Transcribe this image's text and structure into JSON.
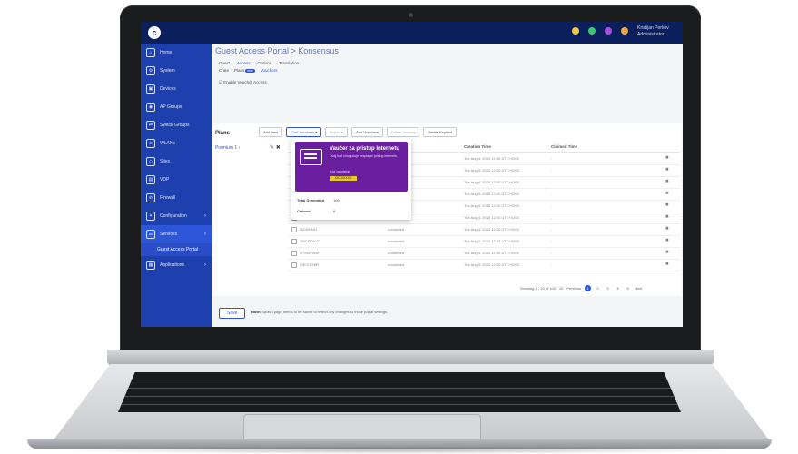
{
  "app": {
    "logo": "c",
    "user_name": "Kristijan Perkov",
    "user_role": "Administrator"
  },
  "header_icons": [
    {
      "name": "alarm-icon",
      "color": "#f5c542"
    },
    {
      "name": "status-icon",
      "color": "#37c871"
    },
    {
      "name": "notification-icon",
      "color": "#a64ee0"
    },
    {
      "name": "task-icon",
      "color": "#f5a442"
    }
  ],
  "sidebar": {
    "items": [
      {
        "label": "Home",
        "icon": "home-icon"
      },
      {
        "label": "System",
        "icon": "system-icon"
      },
      {
        "label": "Devices",
        "icon": "devices-icon"
      },
      {
        "label": "AP Groups",
        "icon": "ap-groups-icon"
      },
      {
        "label": "Switch Groups",
        "icon": "switch-groups-icon"
      },
      {
        "label": "WLANs",
        "icon": "wifi-icon"
      },
      {
        "label": "Sites",
        "icon": "sites-icon"
      },
      {
        "label": "VDP",
        "icon": "vdp-icon"
      },
      {
        "label": "Firewall",
        "icon": "firewall-icon"
      },
      {
        "label": "Configuration",
        "icon": "configuration-icon"
      },
      {
        "label": "Services",
        "icon": "services-icon"
      }
    ],
    "sub_item": "Guest Access Portal",
    "last_item": "Applications"
  },
  "breadcrumb": "Guest Access Portal > Konsensus",
  "tabs_top": [
    "Guest",
    "Access",
    "Options",
    "Translation"
  ],
  "tabs_sub": [
    "Crate",
    "Plans",
    "Vouchers"
  ],
  "tabs_sub_badge": "new",
  "enable_label": "Enable Voucher Access",
  "plans": {
    "title": "Plans",
    "item": "Premium 1"
  },
  "toolbar": {
    "add_new": "Add New",
    "cost_vouchers": "Cost Vouchers",
    "export": "Export",
    "add_vouchers": "Add Vouchers",
    "delete_unused": "Delete Unused",
    "delete_expired": "Delete Expired"
  },
  "table": {
    "col_created": "Creation Time",
    "col_claimed": "Claimed Time",
    "rows": [
      {
        "code": "",
        "status": "",
        "created": "Tue Aug 4, 2020 12:00 UTC+0200",
        "claimed": "-"
      },
      {
        "code": "",
        "status": "",
        "created": "Tue Aug 4, 2020 12:00 UTC+0200",
        "claimed": "-"
      },
      {
        "code": "",
        "status": "",
        "created": "Tue Aug 4, 2020 12:00 UTC+0200",
        "claimed": "-"
      },
      {
        "code": "",
        "status": "",
        "created": "Tue Aug 4, 2020 12:00 UTC+0200",
        "claimed": "-"
      },
      {
        "code": "",
        "status": "",
        "created": "Tue Aug 4, 2020 12:00 UTC+0200",
        "claimed": "-"
      },
      {
        "code": "",
        "status": "",
        "created": "Tue Aug 4, 2020 12:00 UTC+0200",
        "claimed": "-"
      },
      {
        "code": "ACMFA01",
        "status": "unclaimed",
        "created": "Tue Aug 4, 2020 12:00 UTC+0200",
        "claimed": "-"
      },
      {
        "code": "2BCE7W47",
        "status": "unclaimed",
        "created": "Tue Aug 4, 2020 12:00 UTC+0200",
        "claimed": "-"
      },
      {
        "code": "27KM7W8F",
        "status": "unclaimed",
        "created": "Tue Aug 4, 2020 12:00 UTC+0200",
        "claimed": "-"
      },
      {
        "code": "DE374X8R",
        "status": "unclaimed",
        "created": "Tue Aug 4, 2020 12:00 UTC+0200",
        "claimed": "-"
      }
    ]
  },
  "popup": {
    "voucher_title": "Vaučer za pristup Internetu",
    "voucher_text": "Ovaj kod omogućuje besplatan pristup internetu.",
    "code_label": "Kod za pristup",
    "code": "XXXXXXXX",
    "total_label": "Total Generated",
    "total_value": "100",
    "claimed_label": "Claimed",
    "claimed_value": "0"
  },
  "pager": {
    "showing": "Showing 1 - 10 of 100",
    "per_page": "10",
    "prev": "Previous",
    "pages": [
      "1",
      "2",
      "3",
      "4",
      "5"
    ],
    "next": "Next"
  },
  "footer": {
    "save": "Save",
    "note_label": "Note:",
    "note_text": "Splash page needs to be saved to reflect any changes to those portal settings."
  }
}
